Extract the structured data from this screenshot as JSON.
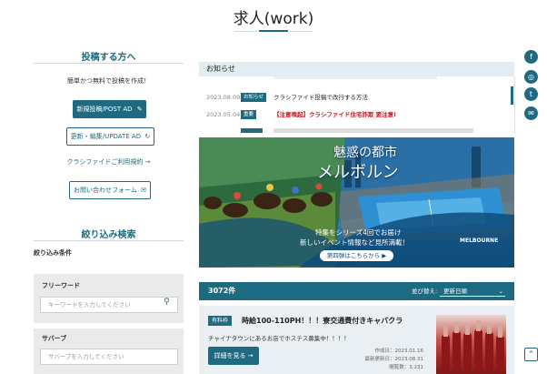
{
  "title": "求人(work)",
  "left": {
    "post_heading": "投稿する方へ",
    "post_intro": "簡単かつ無料で投稿を作成！",
    "new_post_label": "新規投稿/POST AD",
    "update_label": "更新・編集/UPDATE AD",
    "terms_link": "クラシファイドご利用規約 →",
    "contact_label": "お問い合わせフォーム",
    "filter_heading": "絞り込み検索",
    "filter_conditions": "絞り込み条件",
    "freeword_label": "フリーワード",
    "freeword_placeholder": "キーワードを入力してください",
    "suburb_label": "サバーブ",
    "suburb_placeholder": "サバーブを入力してください"
  },
  "news": {
    "header": "お知らせ",
    "items": [
      {
        "date": "2023.08.09",
        "tag": "お知らせ",
        "title": "クラシファイド投稿で改行する方法",
        "color": "#222222"
      },
      {
        "date": "2023.05.04",
        "tag": "重要",
        "title": "【注意喚起】クラシファイド住宅詐欺 要注意!",
        "color": "#d0121b"
      }
    ]
  },
  "banner": {
    "title_line1": "魅惑の都市",
    "title_line2": "メルボルン",
    "sub_line1": "特集をシリーズ4回でお届け",
    "sub_line2": "新しいイベント情報など見所満載！",
    "cta": "第四弾はこちらから ▶",
    "logo": "MELBOURNE"
  },
  "results": {
    "count": "3072件",
    "sort_label": "並び替え:",
    "sort_value": "更新日順"
  },
  "listing": {
    "badge": "有料枠",
    "title": "時給100-110PH！！！寮交通費付きキャバクラ",
    "description": "チャイナタウンにあるお店でホステス募集中！！！！",
    "detail_button": "詳細を見る →",
    "created": "作成日：2023.01.16",
    "updated": "最新更新日：2023.08.31",
    "views": "閲覧数：3,231"
  },
  "social": {
    "facebook": "f",
    "instagram": "◎",
    "twitter": "t",
    "mail": "✉"
  },
  "colors": {
    "accent": "#1e6a80",
    "alert": "#d0121b"
  }
}
